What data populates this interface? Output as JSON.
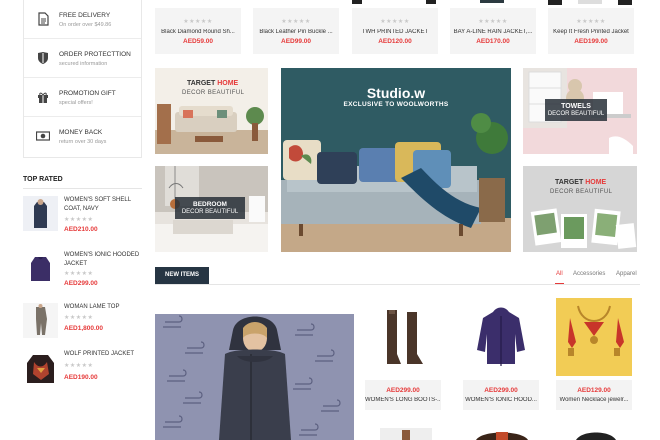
{
  "services": [
    {
      "icon": "document-icon",
      "title": "FREE DELIVERY",
      "subtitle": "On order over $49.86"
    },
    {
      "icon": "shield-icon",
      "title": "ORDER PROTECTTION",
      "subtitle": "secured information"
    },
    {
      "icon": "gift-icon",
      "title": "PROMOTION GIFT",
      "subtitle": "special offers!"
    },
    {
      "icon": "money-icon",
      "title": "MONEY BACK",
      "subtitle": "return over 30 days"
    }
  ],
  "top_rated": {
    "title": "TOP RATED",
    "items": [
      {
        "name": "WOMEN'S SOFT SHELL COAT, NAVY",
        "stars": "★★★★★",
        "price": "AED210.00"
      },
      {
        "name": "WOMEN'S IONIC HOODED JACKET",
        "stars": "★★★★★",
        "price": "AED299.00"
      },
      {
        "name": "Woman Lame Top",
        "stars": "★★★★★",
        "price": "AED1,800.00"
      },
      {
        "name": "WOLF Printed Jacket",
        "stars": "★★★★★",
        "price": "AED190.00"
      }
    ]
  },
  "top_products": [
    {
      "name": "Black Diamond Round Sh...",
      "stars": "★★★★★",
      "price": "AED59.00"
    },
    {
      "name": "Black Leather Pin Buckle ...",
      "stars": "★★★★★",
      "price": "AED99.00"
    },
    {
      "name": "TWH PRINTED JACKET",
      "stars": "★★★★★",
      "price": "AED120.00"
    },
    {
      "name": "BAY A-LINE RAIN JACKET,...",
      "stars": "★★★★★",
      "price": "AED170.00"
    },
    {
      "name": "Keep It Fresh Printed Jacket",
      "stars": "★★★★★",
      "price": "AED199.00"
    }
  ],
  "banners": {
    "target_home": {
      "title_a": "TARGET",
      "title_b": "HOME",
      "subtitle": "DECOR BEAUTIFUL"
    },
    "studio": {
      "title": "Studio.w",
      "subtitle": "EXCLUSIVE TO WOOLWORTHS"
    },
    "towels": {
      "title": "TOWELS",
      "subtitle": "DECOR BEAUTIFUL"
    },
    "bedroom": {
      "title": "BEDROOM",
      "subtitle": "DECOR BEAUTIFUL"
    },
    "target_home_2": {
      "title_a": "TARGET",
      "title_b": "HOME",
      "subtitle": "DECOR BEAUTIFUL"
    }
  },
  "new_items": {
    "tab_label": "NEW ITEMS",
    "filters": [
      "All",
      "Accessories",
      "Apparel"
    ],
    "active_filter": "All",
    "products": [
      {
        "name": "WOMEN'S LONG BOOTS-...",
        "price": "AED299.00"
      },
      {
        "name": "WOMEN'S IONIC HOOD...",
        "price": "AED299.00"
      },
      {
        "name": "Women Necklace jewelr...",
        "price": "AED129.00"
      }
    ]
  },
  "colors": {
    "accent": "#e63a3a",
    "dark_tab": "#263543",
    "teal_banner": "#2f5b63"
  }
}
